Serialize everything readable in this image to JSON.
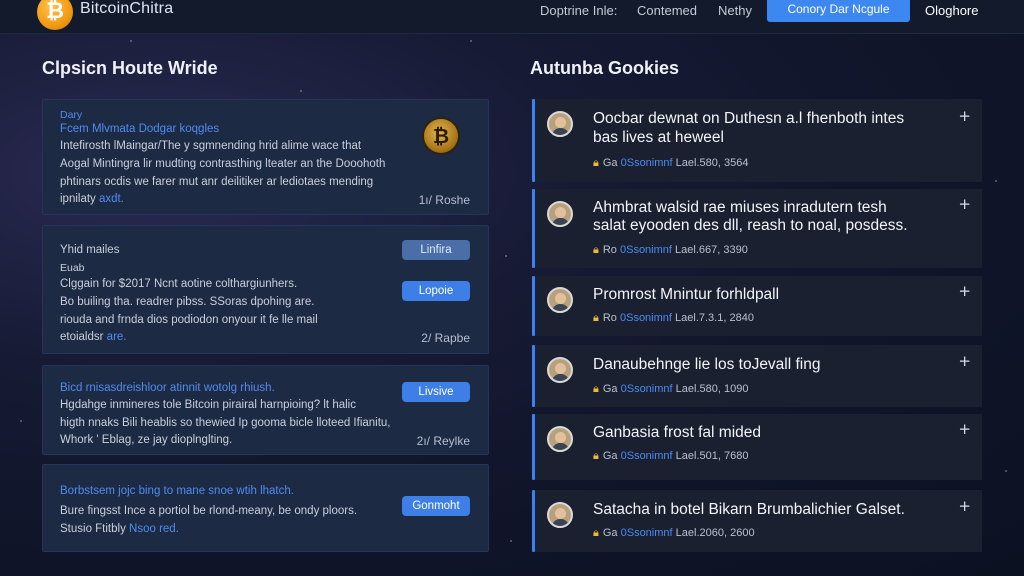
{
  "header": {
    "brand": "BitcoinChitra",
    "nav": [
      "Doptrine Inle:",
      "Contemed",
      "Nethy"
    ],
    "cta_button": "Conory Dar Ncgule",
    "login": "Ologhore"
  },
  "left": {
    "title": "Clpsicn Houte Wride",
    "cards": [
      {
        "lines": [
          {
            "text": "Dary",
            "blue": true
          },
          {
            "text": "Fcem Mlvmata Dodgar koqgles",
            "blue": true
          },
          {
            "text": "Intefirosth lMaingar/The y sgmnending hrid alime wace that",
            "blue": false
          },
          {
            "text": "Aogal Mintingra lir mudting contrasthing lteater an the Dooohoth",
            "blue": false
          },
          {
            "text": "phtinars ocdis we farer mut anr deilitiker ar lediotaes mending",
            "blue": false
          }
        ],
        "last_line": "ipnilaty",
        "last_link": "axdt.",
        "coin_symbol": "₿",
        "meta": "1ı/  Roshe"
      },
      {
        "lines": [
          {
            "text": "Yhid mailes",
            "blue": false
          },
          {
            "text": "Euab",
            "blue": false
          },
          {
            "text": "Clggain for $2017 Ncnt aotine colthargiunhers.",
            "blue": false
          },
          {
            "text": "Bo builing tha. readrer pibss. SSoras dpohing are.",
            "blue": false
          },
          {
            "text": "riouda and frnda dios podiodon onyour it fe lle mail",
            "blue": false
          }
        ],
        "last_line": "etoialdsr",
        "last_link": "are.",
        "pills": [
          "Linfira",
          "Lopoie"
        ],
        "meta": "2/  Rapbe"
      },
      {
        "lines": [
          {
            "text": "Bicd rnisasdreishloor atinnit wotolg rhiush.",
            "blue": true
          },
          {
            "text": "Hgdahge inmineres tole Bitcoin pirairal harnpioing? lt halic",
            "blue": false
          },
          {
            "text": "higth nnaks Bili heablis so thewied Ip gooma bicle lloteed Ifianitu,",
            "blue": false
          }
        ],
        "last_line": "Whork ' Eblag, ze jay dioplnglting.",
        "last_link": "",
        "pills": [
          "Livsive"
        ],
        "meta": "2ı/  Reylke"
      },
      {
        "lines": [
          {
            "text": "Borbstsem jojc bing to mane snoe wtih lhatch.",
            "blue": true
          },
          {
            "text": "Bure fingsst Ince a portiol be rlond-meany, be ondy ploors.",
            "blue": false
          }
        ],
        "last_line": "Stusio Ftitbly",
        "last_link": "Nsoo red.",
        "pills": [
          "Gonmoht"
        ],
        "meta": ""
      }
    ]
  },
  "right": {
    "title": "Autunba Gookies",
    "items": [
      {
        "title": [
          "Oocbar dewnat on Duthesn a.l fhenboth intes",
          "bas lives at heweel"
        ],
        "prefix": "Ga",
        "link": "0Ssonimnf",
        "meta": "Lael.580, 3564"
      },
      {
        "title": [
          "Ahmbrat walsid rae miuses inradutern tesh",
          "salat eyooden des dll, reash to noal, posdess."
        ],
        "prefix": "Ro",
        "link": "0Ssonimnf",
        "meta": "Lael.667, 3390"
      },
      {
        "title": [
          "Promrost Mnintur forhldpall"
        ],
        "prefix": "Ro",
        "link": "0Ssonimnf",
        "meta": "Lael.7.3.1, 2840"
      },
      {
        "title": [
          "Danaubehnge lie los toJevall fing"
        ],
        "prefix": "Ga",
        "link": "0Ssonimnf",
        "meta": "Lael.580, 1090"
      },
      {
        "title": [
          "Ganbasia frost fal mided"
        ],
        "prefix": "Ga",
        "link": "0Ssonimnf",
        "meta": "Lael.501, 7680"
      },
      {
        "title": [
          "Satacha in botel Bikarn Brumbalichier Galset."
        ],
        "prefix": "Ga",
        "link": "0Ssonimnf",
        "meta": "Lael.2060, 2600"
      }
    ]
  },
  "colors": {
    "accent": "#3d88f0",
    "card_bg": "#1d2a44",
    "item_bg": "#1a2030",
    "lock": "#f1b83a",
    "coin": "#e1b64c"
  },
  "icons": [
    "bitcoin-logo-icon",
    "bitcoin-coin-icon",
    "lock-icon",
    "plus-icon",
    "avatar-icon"
  ]
}
